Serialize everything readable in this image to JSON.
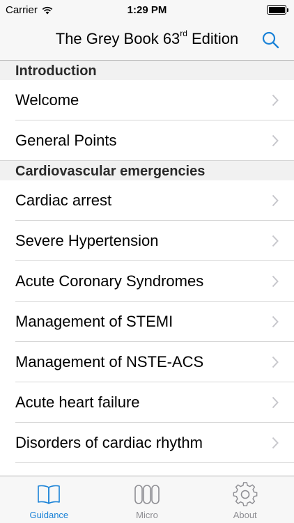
{
  "status_bar": {
    "carrier": "Carrier",
    "time": "1:29 PM",
    "battery_level": 1.0
  },
  "nav": {
    "title_main": "The Grey Book 63",
    "title_sup": "rd",
    "title_suffix": "Edition"
  },
  "sections": [
    {
      "header": "Introduction",
      "items": [
        "Welcome",
        "General Points"
      ]
    },
    {
      "header": "Cardiovascular emergencies",
      "items": [
        "Cardiac arrest",
        "Severe Hypertension",
        "Acute Coronary Syndromes",
        "Management of STEMI",
        "Management of NSTE-ACS",
        "Acute heart failure",
        "Disorders of cardiac rhythm"
      ]
    }
  ],
  "tabs": [
    {
      "label": "Guidance",
      "icon": "book-icon",
      "active": true
    },
    {
      "label": "Micro",
      "icon": "bacteria-icon",
      "active": false
    },
    {
      "label": "About",
      "icon": "gear-icon",
      "active": false
    }
  ],
  "colors": {
    "accent": "#1a82d7",
    "inactive": "#8e8e93",
    "section_bg": "#f1f1f1",
    "bar_bg": "#f7f7f7"
  }
}
